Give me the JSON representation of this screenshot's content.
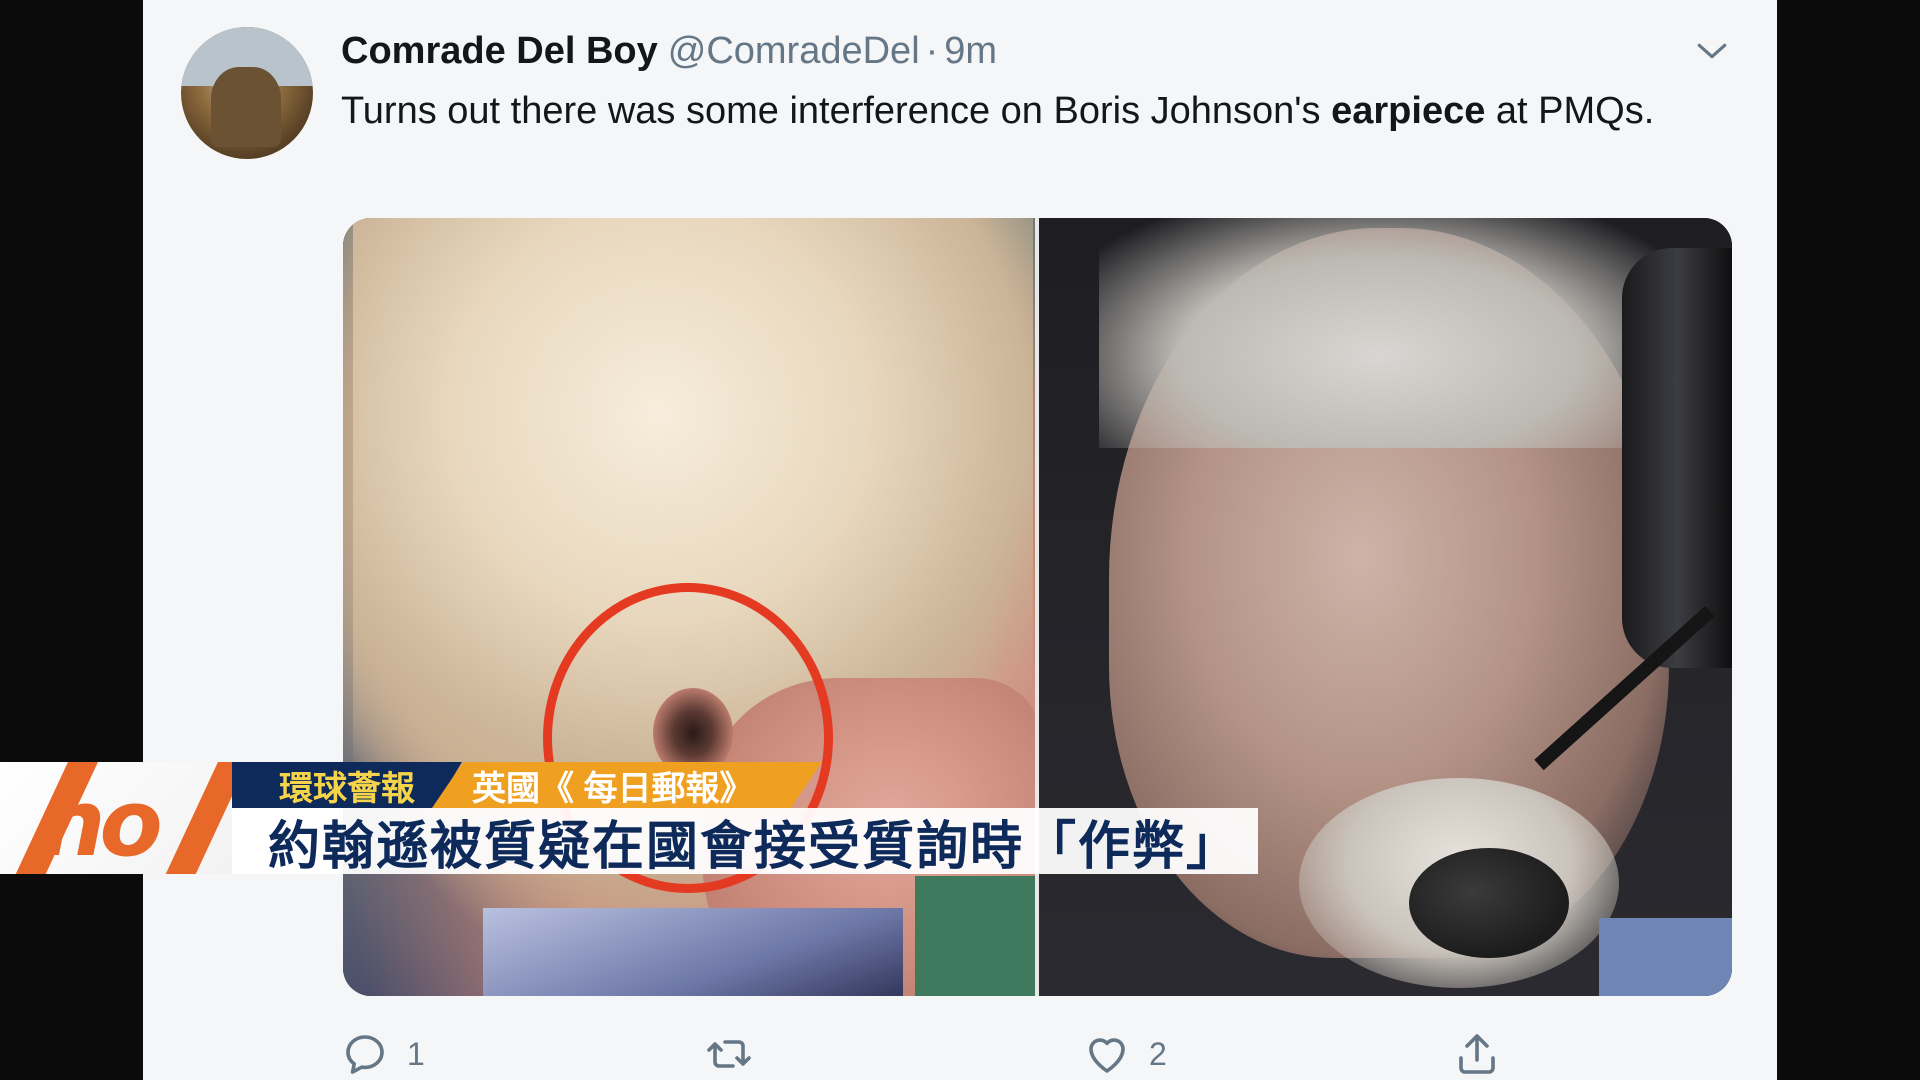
{
  "tweet": {
    "display_name": "Comrade Del Boy",
    "handle": "@ComradeDel",
    "separator": "·",
    "time": "9m",
    "text_before": "Turns out there was some interference on Boris Johnson's ",
    "text_bold": "earpiece",
    "text_after": " at PMQs."
  },
  "actions": {
    "reply_count": "1",
    "retweet_count": "",
    "like_count": "2"
  },
  "ticker": {
    "logo_text": "no",
    "program": "環球薈報",
    "source": "英國《 每日郵報》",
    "headline": "約翰遜被質疑在國會接受質詢時「作弊」"
  },
  "colors": {
    "card_bg": "#f5f6f7",
    "text": "#14171a",
    "muted": "#657786",
    "circle": "#e43a22",
    "ticker_navy": "#0d2a5a",
    "ticker_gold": "#f5d34a",
    "ticker_orange": "#f0a021"
  },
  "icons": {
    "reply": "reply-icon",
    "retweet": "retweet-icon",
    "like": "heart-icon",
    "share": "share-icon",
    "menu": "chevron-down-icon"
  }
}
